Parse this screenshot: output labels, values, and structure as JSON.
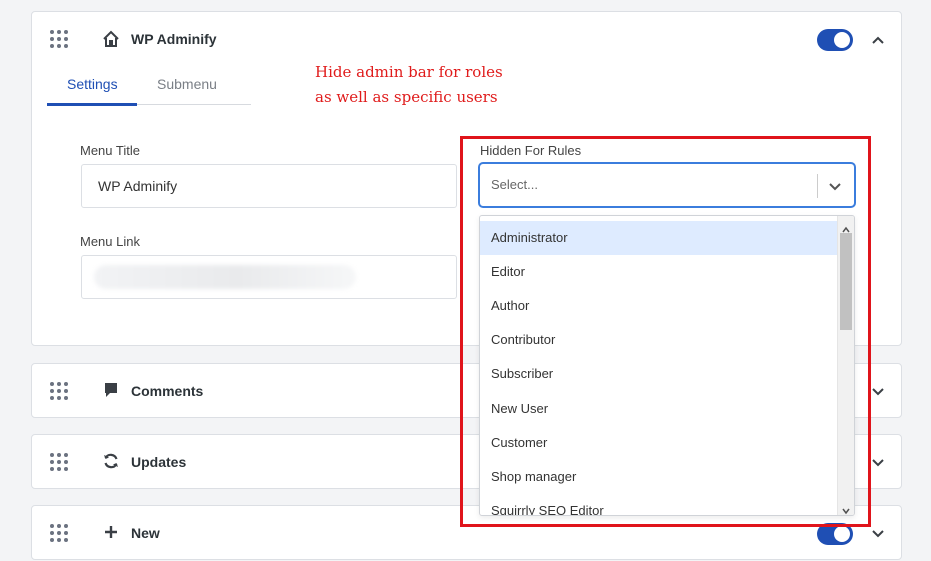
{
  "main_panel": {
    "title": "WP Adminify",
    "icon": "home-icon",
    "toggle_on": true,
    "tabs": [
      {
        "label": "Settings",
        "active": true
      },
      {
        "label": "Submenu",
        "active": false
      }
    ],
    "fields": {
      "menu_title": {
        "label": "Menu Title",
        "value": "WP Adminify"
      },
      "menu_link": {
        "label": "Menu Link",
        "value": ""
      }
    },
    "hidden_for": {
      "label": "Hidden For Rules",
      "placeholder": "Select...",
      "options": [
        "Administrator",
        "Editor",
        "Author",
        "Contributor",
        "Subscriber",
        "New User",
        "Customer",
        "Shop manager",
        "Squirrly SEO Editor"
      ],
      "highlighted": "Administrator"
    }
  },
  "annotation": {
    "line1": "Hide admin bar for roles",
    "line2": "as well as specific users",
    "color": "#e01b1b"
  },
  "rows": [
    {
      "title": "Comments",
      "icon": "comment-icon",
      "toggle_visible": false
    },
    {
      "title": "Updates",
      "icon": "refresh-icon",
      "toggle_visible": false
    },
    {
      "title": "New",
      "icon": "plus-icon",
      "toggle_visible": true
    }
  ],
  "colors": {
    "accent": "#1f4fb4",
    "highlight": "#deebff",
    "focus": "#3b7ddd"
  }
}
